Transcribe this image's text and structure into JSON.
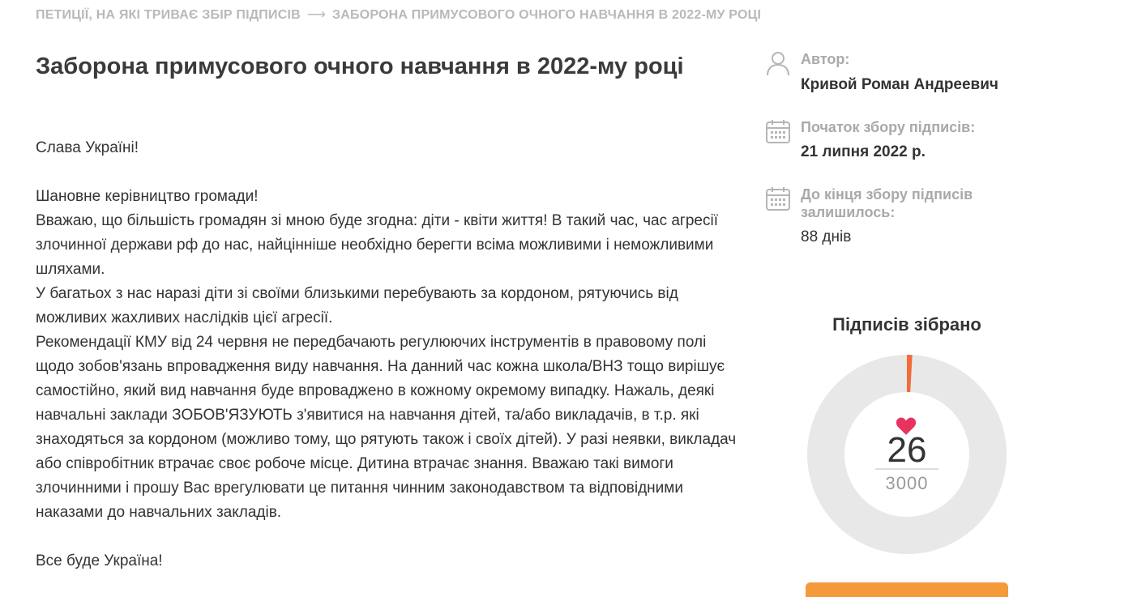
{
  "breadcrumb": {
    "parent": "ПЕТИЦІЇ, НА ЯКІ ТРИВАЄ ЗБІР ПІДПИСІВ",
    "separator": "⟶",
    "current": "ЗАБОРОНА ПРИМУСОВОГО ОЧНОГО НАВЧАННЯ В 2022-МУ РОЦІ"
  },
  "petition": {
    "title": "Заборона примусового очного навчання в 2022-му році",
    "greeting": "Слава Україні!",
    "paragraphs": [
      "Шановне керівництво громади!",
      "Вважаю, що більшість громадян зі мною буде згодна: діти - квіти життя! В такий час, час агресії злочинної держави рф до нас, найцінніше необхідно берегти всіма можливими і неможливими шляхами.",
      "У багатьох з нас наразі діти зі своїми близькими перебувають за кордоном, рятуючись від можливих жахливих наслідків цієї агресії.",
      "Рекомендації КМУ від 24 червня не передбачають регулюючих інструментів в правовому полі щодо зобов'язань впровадження виду навчання. На данний час кожна школа/ВНЗ тощо вирішує самостійно, який вид навчання буде впроваджено в кожному окремому випадку. Нажаль, деякі навчальні заклади ЗОБОВ'ЯЗУЮТЬ з'явитися на навчання дітей, та/або викладачів, в т.р. які знаходяться за кордоном (можливо тому, що рятують також і своїх дітей). У разі неявки, викладач або співробітник втрачає своє робоче місце. Дитина втрачає знання. Вважаю такі вимоги злочинними і прошу Вас врегулювати це питання чинним законодавством та відповідними наказами до навчальних закладів."
    ],
    "closing": "Все буде Україна!"
  },
  "meta": {
    "author_label": "Автор:",
    "author_value": "Кривой Роман Андреевич",
    "start_label": "Початок збору підписів:",
    "start_value": "21 липня 2022 р.",
    "remaining_label": "До кінця збору підписів залишилось:",
    "remaining_value": "88 днів"
  },
  "signatures": {
    "title": "Підписів зібрано",
    "collected": "26",
    "goal": "3000",
    "progress": 0.0087
  },
  "colors": {
    "accent": "#f26b3a",
    "button": "#f59a3b",
    "heart": "#e8335f",
    "ring_track": "#e8e8e8"
  },
  "icons": {
    "author": "user-icon",
    "start": "calendar-icon",
    "remaining": "calendar-icon",
    "heart": "heart-icon"
  }
}
